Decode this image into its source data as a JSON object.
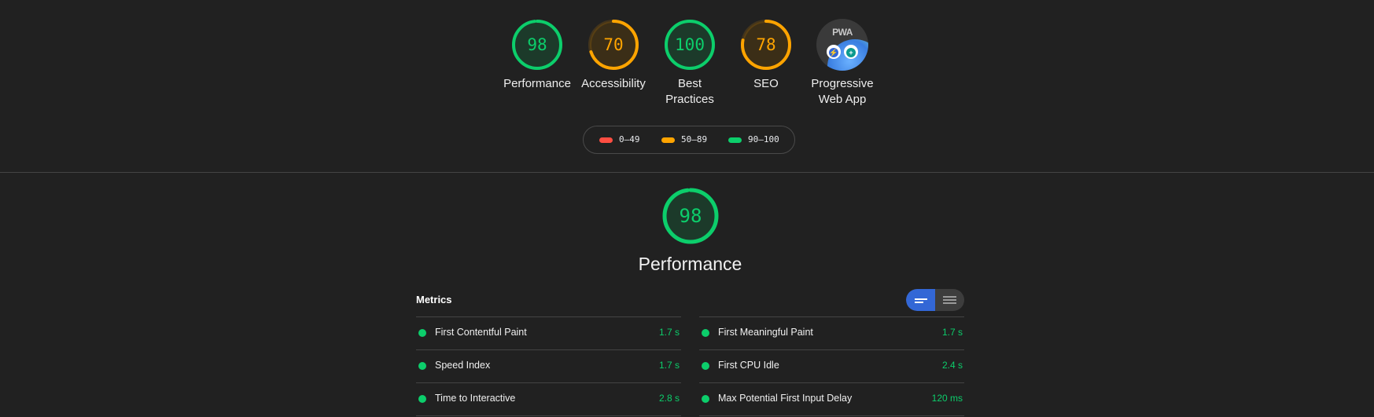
{
  "categories": [
    {
      "score": "98",
      "label": "Performance",
      "fraction": 0.98,
      "color": "#0cce6b"
    },
    {
      "score": "70",
      "label": "Accessibility",
      "fraction": 0.7,
      "color": "#ffa400"
    },
    {
      "score": "100",
      "label": "Best Practices",
      "fraction": 1.0,
      "color": "#0cce6b"
    },
    {
      "score": "78",
      "label": "SEO",
      "fraction": 0.78,
      "color": "#ffa400"
    }
  ],
  "pwa": {
    "badge_text": "PWA",
    "label": "Progressive Web App"
  },
  "legend": [
    {
      "range": "0–49",
      "color": "#ff4e42"
    },
    {
      "range": "50–89",
      "color": "#ffa400"
    },
    {
      "range": "90–100",
      "color": "#0cce6b"
    }
  ],
  "performance": {
    "score": "98",
    "title": "Performance",
    "fraction": 0.98
  },
  "metrics": {
    "heading": "Metrics",
    "left": [
      {
        "name": "First Contentful Paint",
        "value": "1.7 s"
      },
      {
        "name": "Speed Index",
        "value": "1.7 s"
      },
      {
        "name": "Time to Interactive",
        "value": "2.8 s"
      }
    ],
    "right": [
      {
        "name": "First Meaningful Paint",
        "value": "1.7 s"
      },
      {
        "name": "First CPU Idle",
        "value": "2.4 s"
      },
      {
        "name": "Max Potential First Input Delay",
        "value": "120 ms"
      }
    ]
  }
}
